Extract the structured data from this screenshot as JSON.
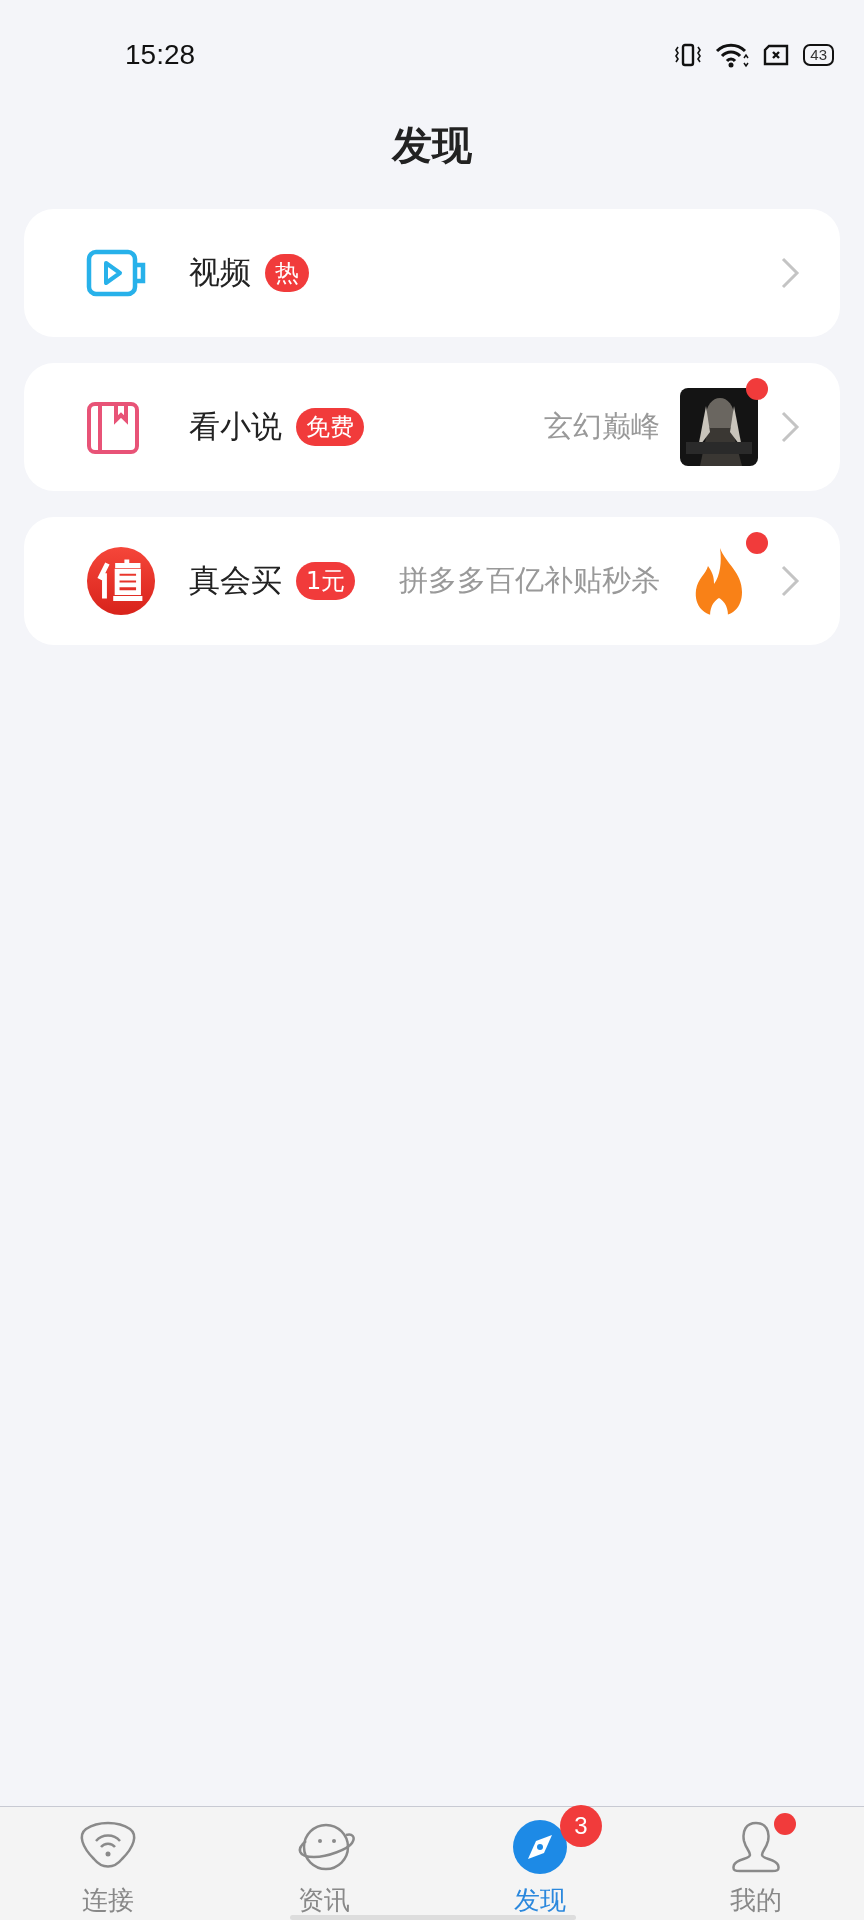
{
  "status_bar": {
    "time": "15:28",
    "battery": "43"
  },
  "title": "发现",
  "items": [
    {
      "kind": "video",
      "label": "视频",
      "badge": "热"
    },
    {
      "kind": "novel",
      "label": "看小说",
      "badge": "免费",
      "subtitle": "玄幻巅峰",
      "dot": true
    },
    {
      "kind": "shop",
      "label": "真会买",
      "badge": "1元",
      "subtitle": "拼多多百亿补贴秒杀",
      "dot": true
    }
  ],
  "tabs": [
    {
      "kind": "wifi",
      "label": "连接",
      "selected": false,
      "dot": false
    },
    {
      "kind": "planet",
      "label": "资讯",
      "selected": false,
      "dot": false
    },
    {
      "kind": "compass",
      "label": "发现",
      "selected": true,
      "badge": "3",
      "dot": false
    },
    {
      "kind": "person",
      "label": "我的",
      "selected": false,
      "dot": true
    }
  ]
}
